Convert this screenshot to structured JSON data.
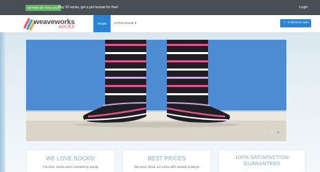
{
  "topbar": {
    "offer_badge": "OFFER OF THE DAY",
    "offer_text": "Buy 10 socks, get a pet human for free!",
    "login": "Login"
  },
  "navbar": {
    "logo_word": "weaveworks",
    "logo_socks": "socks",
    "home": "HOME",
    "catalogue": "CATALOGUE ▾",
    "cart": "🛒 0 items in cart"
  },
  "hero": {
    "carousel_pages": 3,
    "active_page": 3
  },
  "cards": [
    {
      "title": "WE LOVE SOCKS!",
      "body": "Fun fact: Socks were invented by woolly"
    },
    {
      "title": "BEST PRICES",
      "body": "We price check our socks with trained monkeys"
    },
    {
      "title": "100% SATISFACTION GUARANTEED",
      "body": ""
    }
  ],
  "colors": {
    "topbar": "#474f55",
    "accent": "#2a84d2",
    "offer_green": "#5cb85c",
    "logo_red": "#e8555a"
  }
}
